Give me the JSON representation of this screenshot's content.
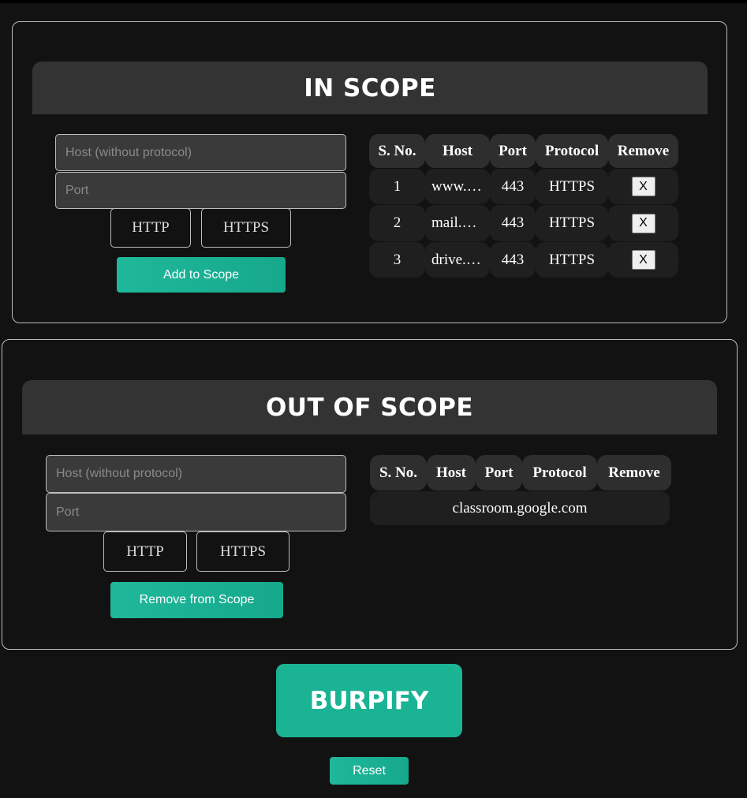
{
  "in_scope": {
    "title": "IN SCOPE",
    "host_placeholder": "Host (without protocol)",
    "port_placeholder": "Port",
    "http_label": "HTTP",
    "https_label": "HTTPS",
    "add_label": "Add to Scope",
    "headers": [
      "S. No.",
      "Host",
      "Port",
      "Protocol",
      "Remove"
    ],
    "rows": [
      {
        "sno": "1",
        "host": "www.google.com",
        "port": "443",
        "protocol": "HTTPS",
        "remove": "X"
      },
      {
        "sno": "2",
        "host": "mail.google.com",
        "port": "443",
        "protocol": "HTTPS",
        "remove": "X"
      },
      {
        "sno": "3",
        "host": "drive.google.com",
        "port": "443",
        "protocol": "HTTPS",
        "remove": "X"
      }
    ]
  },
  "out_scope": {
    "title": "OUT OF SCOPE",
    "host_placeholder": "Host (without protocol)",
    "port_placeholder": "Port",
    "http_label": "HTTP",
    "https_label": "HTTPS",
    "remove_label": "Remove from Scope",
    "headers": [
      "S. No.",
      "Host",
      "Port",
      "Protocol",
      "Remove"
    ],
    "rows": [
      {
        "value": "classroom.google.com"
      }
    ]
  },
  "actions": {
    "burpify_label": "BURPIFY",
    "reset_label": "Reset"
  },
  "colors": {
    "accent": "#1ab394",
    "background": "#121212",
    "header_bg": "#333333"
  }
}
